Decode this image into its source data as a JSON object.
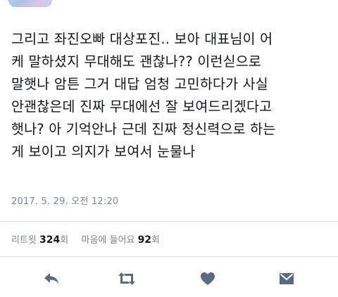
{
  "tweet": {
    "text": "그리고 좌진오빠 대상포진.. 보아 대표님이 어\n케 말하셨지 무대해도 괜찮나?? 이런싣으로\n말햇나 암튼 그거 대답 엄청 고민하다가 사실\n안괜찮은데 진짜 무대에선 잘 보여드리겠다고\n햇나? 아 기억안나 근데 진짜 정신력으로 하는\n게 보이고 의지가 보여서 눈물나",
    "timestamp": "2017. 5. 29. 오전 12:20"
  },
  "stats": {
    "retweets_label": "리트윗",
    "retweets_count": "324",
    "retweets_unit": "회",
    "likes_label": "마음에 들어요",
    "likes_count": "92",
    "likes_unit": "회"
  },
  "actions": [
    "reply-icon",
    "retweet-icon",
    "like-heart-icon",
    "direct-message-icon"
  ],
  "colors": {
    "text": "#14171a",
    "muted": "#7b8794",
    "icon": "#5b6b7c",
    "divider": "#e1e8ed"
  }
}
